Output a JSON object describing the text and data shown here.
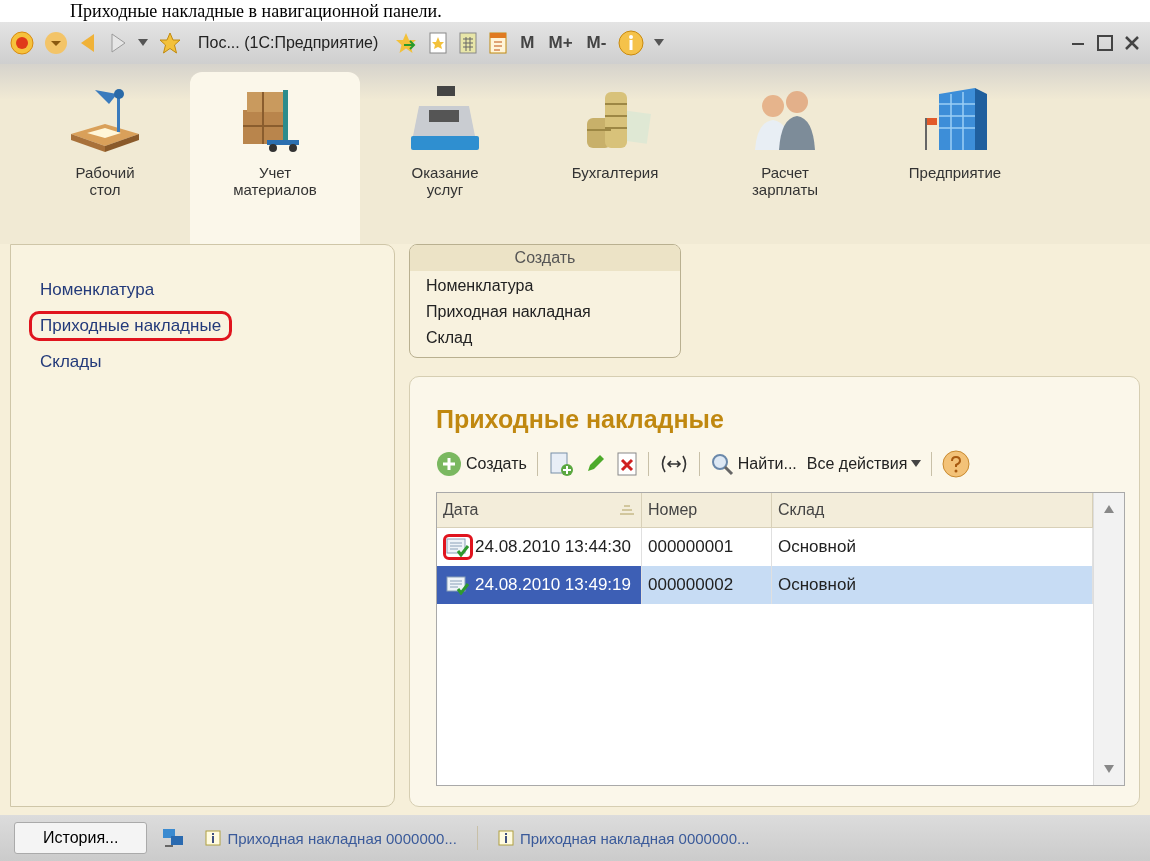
{
  "caption": "Приходные накладные в навигационной панели.",
  "titlebar": {
    "title": "Пос... (1С:Предприятие)",
    "memory_buttons": [
      "M",
      "M+",
      "M-"
    ]
  },
  "sections": [
    {
      "label": "Рабочий\nстол",
      "kind": "desk",
      "selected": false
    },
    {
      "label": "Учет\nматериалов",
      "kind": "boxes",
      "selected": true
    },
    {
      "label": "Оказание\nуслуг",
      "kind": "register",
      "selected": false
    },
    {
      "label": "Бухгалтерия",
      "kind": "coins",
      "selected": false
    },
    {
      "label": "Расчет\nзарплаты",
      "kind": "people",
      "selected": false
    },
    {
      "label": "Предприятие",
      "kind": "building",
      "selected": false
    }
  ],
  "navigation": [
    {
      "label": "Номенклатура",
      "highlighted": false
    },
    {
      "label": "Приходные накладные",
      "highlighted": true
    },
    {
      "label": "Склады",
      "highlighted": false
    }
  ],
  "create_panel": {
    "title": "Создать",
    "items": [
      "Номенклатура",
      "Приходная накладная",
      "Склад"
    ]
  },
  "list": {
    "title": "Приходные накладные",
    "create": "Создать",
    "find": "Найти...",
    "all_actions": "Все действия",
    "columns": [
      "Дата",
      "Номер",
      "Склад"
    ],
    "rows": [
      {
        "date": "24.08.2010 13:44:30",
        "number": "000000001",
        "warehouse": "Основной",
        "selected": false,
        "highlighted": true
      },
      {
        "date": "24.08.2010 13:49:19",
        "number": "000000002",
        "warehouse": "Основной",
        "selected": true,
        "highlighted": false
      }
    ]
  },
  "status_bar": {
    "history": "История...",
    "messages": [
      "Приходная накладная 0000000...",
      "Приходная накладная 0000000..."
    ]
  }
}
